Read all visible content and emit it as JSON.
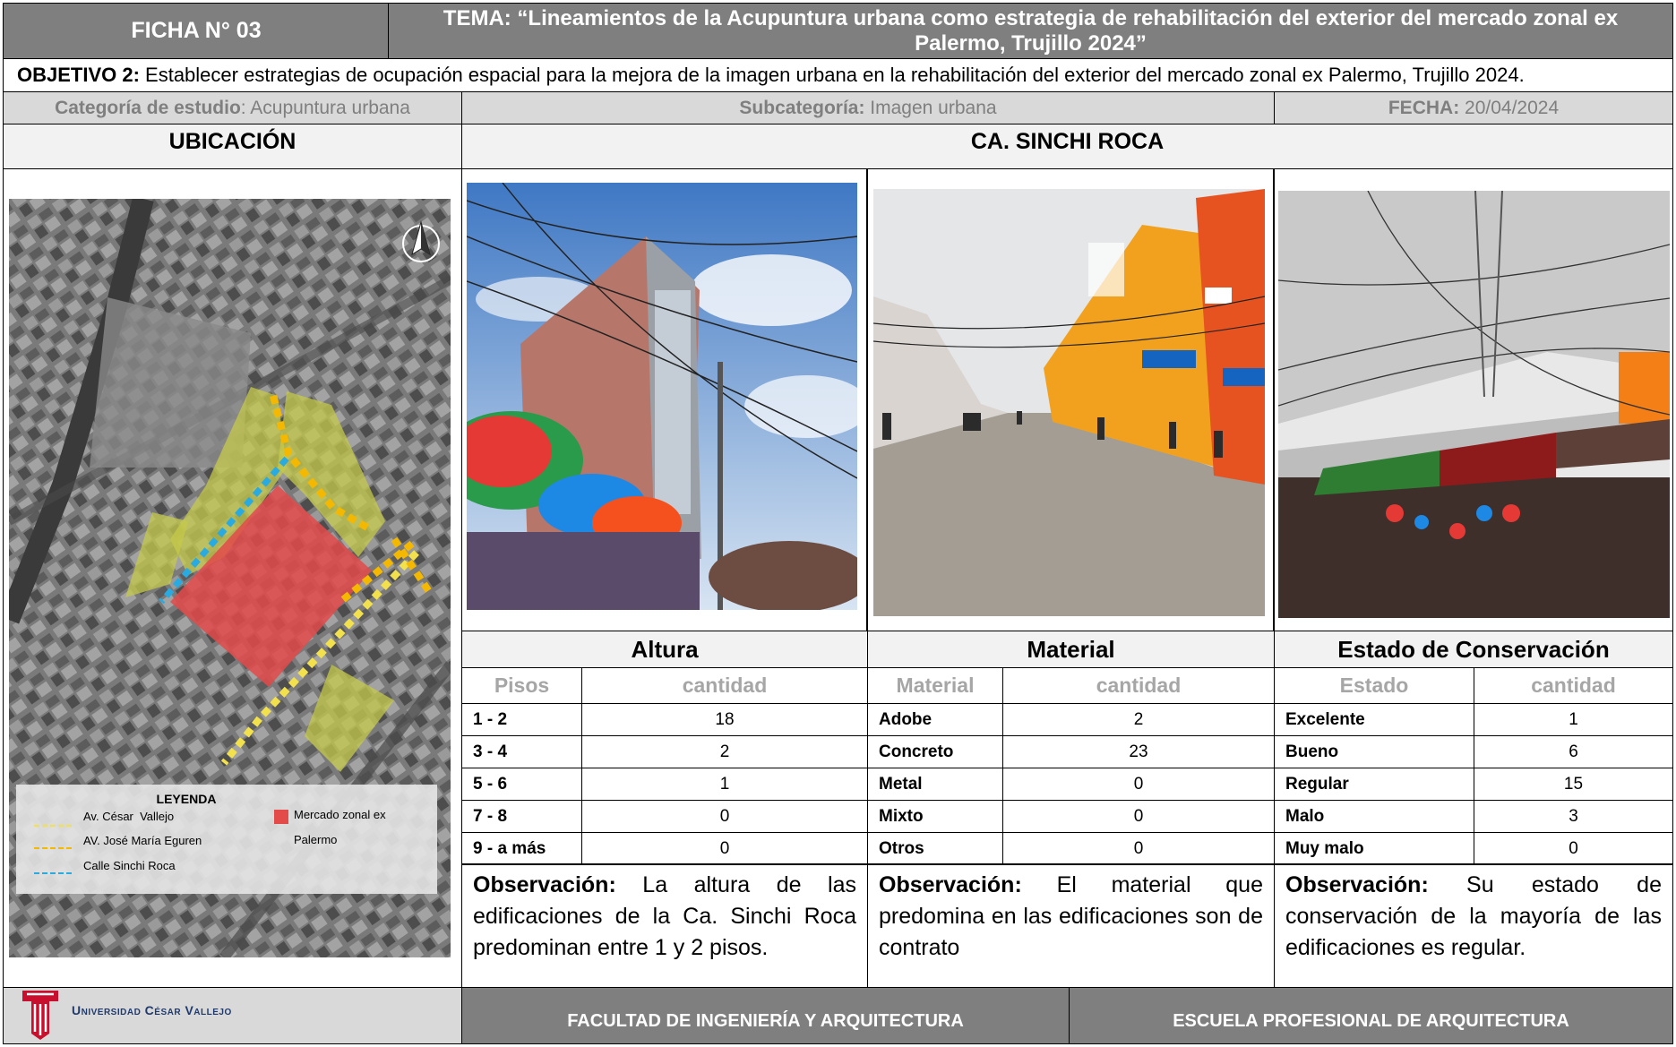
{
  "header": {
    "ficha": "FICHA N° 03",
    "tema": "TEMA: “Lineamientos de la Acupuntura urbana como estrategia de rehabilitación del exterior del mercado zonal ex Palermo, Trujillo 2024”"
  },
  "objetivo": {
    "label": "OBJETIVO 2:",
    "text": " Establecer estrategias de ocupación espacial para la mejora de la imagen urbana en la rehabilitación del exterior del mercado zonal ex Palermo, Trujillo 2024."
  },
  "meta": {
    "categoria_label": "Categoría de estudio",
    "categoria_value": ": Acupuntura urbana",
    "subcategoria_label": "Subcategoría:",
    "subcategoria_value": " Imagen urbana",
    "fecha_label": "FECHA:",
    "fecha_value": " 20/04/2024"
  },
  "ubicacion": {
    "title": "UBICACIÓN",
    "legend": {
      "title": "LEYENDA",
      "items": [
        {
          "label": "Av. César  Vallejo",
          "color": "#f2e14c"
        },
        {
          "label": "AV. José María Eguren",
          "color": "#f5b800"
        },
        {
          "label": "Calle Sinchi Roca",
          "color": "#29abe2"
        }
      ],
      "market_label_1": "Mercado zonal ex",
      "market_label_2": "Palermo",
      "market_color": "#e34a4a"
    }
  },
  "street": {
    "title": "CA. SINCHI ROCA"
  },
  "altura": {
    "title": "Altura",
    "col1": "Pisos",
    "col2": "cantidad",
    "rows": [
      {
        "label": "1 - 2",
        "value": "18"
      },
      {
        "label": "3 - 4",
        "value": "2"
      },
      {
        "label": "5 - 6",
        "value": "1"
      },
      {
        "label": "7 - 8",
        "value": "0"
      },
      {
        "label": "9 - a más",
        "value": "0"
      }
    ],
    "obs_label": "Observación:",
    "obs_text": " La altura de las edificaciones de la Ca. Sinchi Roca predominan  entre 1 y 2 pisos."
  },
  "material": {
    "title": "Material",
    "col1": "Material",
    "col2": "cantidad",
    "rows": [
      {
        "label": "Adobe",
        "value": "2"
      },
      {
        "label": "Concreto",
        "value": "23"
      },
      {
        "label": "Metal",
        "value": "0"
      },
      {
        "label": "Mixto",
        "value": "0"
      },
      {
        "label": "Otros",
        "value": "0"
      }
    ],
    "obs_label": "Observación:",
    "obs_text": " El material que predomina en las edificaciones son de contrato"
  },
  "estado": {
    "title": "Estado de Conservación",
    "col1": "Estado",
    "col2": "cantidad",
    "rows": [
      {
        "label": "Excelente",
        "value": "1"
      },
      {
        "label": "Bueno",
        "value": "6"
      },
      {
        "label": "Regular",
        "value": "15"
      },
      {
        "label": "Malo",
        "value": "3"
      },
      {
        "label": "Muy malo",
        "value": "0"
      }
    ],
    "obs_label": "Observación:",
    "obs_text": " Su estado de conservación de la mayoría de las edificaciones es regular."
  },
  "footer": {
    "university": "Universidad César Vallejo",
    "facultad": "FACULTAD DE INGENIERÍA Y ARQUITECTURA",
    "escuela": "ESCUELA PROFESIONAL DE ARQUITECTURA",
    "logo_color": "#c8102e"
  }
}
